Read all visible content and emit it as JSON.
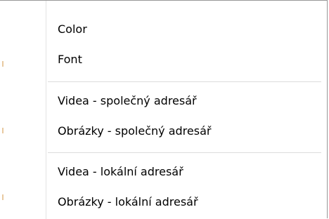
{
  "context_menu": {
    "groups": [
      {
        "items": [
          {
            "label": "Color"
          },
          {
            "label": "Font"
          }
        ]
      },
      {
        "items": [
          {
            "label": "Videa - společný adresář"
          },
          {
            "label": "Obrázky - společný adresář"
          }
        ]
      },
      {
        "items": [
          {
            "label": "Videa - lokální adresář"
          },
          {
            "label": "Obrázky - lokální adresář"
          }
        ]
      }
    ]
  }
}
